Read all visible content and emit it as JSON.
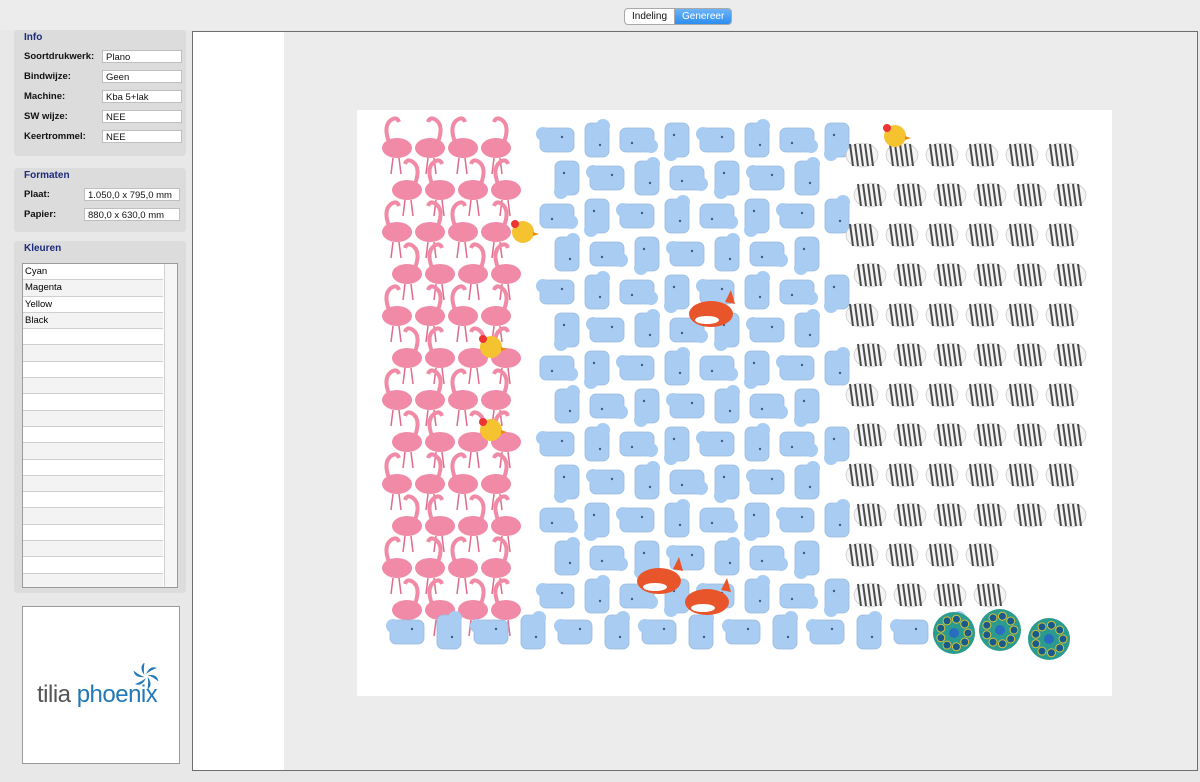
{
  "toolbar": {
    "tabs": [
      "Indeling",
      "Genereer"
    ],
    "active_tab": "Genereer"
  },
  "info": {
    "title": "Info",
    "fields": [
      {
        "label": "Soortdrukwerk:",
        "value": "Plano"
      },
      {
        "label": "Bindwijze:",
        "value": "Geen"
      },
      {
        "label": "Machine:",
        "value": "Kba 5+lak"
      },
      {
        "label": "SW wijze:",
        "value": "NEE"
      },
      {
        "label": "Keertrommel:",
        "value": "NEE"
      }
    ]
  },
  "formaten": {
    "title": "Formaten",
    "fields": [
      {
        "label": "Plaat:",
        "value": "1.050,0 x 795,0 mm"
      },
      {
        "label": "Papier:",
        "value": "880,0 x 630,0 mm"
      }
    ]
  },
  "kleuren": {
    "title": "Kleuren",
    "items": [
      "Cyan",
      "Magenta",
      "Yellow",
      "Black"
    ]
  },
  "logo": {
    "word1": "tilia",
    "word2": "phoenix"
  },
  "colors": {
    "flamingo": "#f08aa6",
    "elephant": "#a9cdf2",
    "zebra": "#4a4a4a",
    "fox": "#e8552a",
    "chick": "#f5c230",
    "peacock": "#2a9b8e"
  }
}
